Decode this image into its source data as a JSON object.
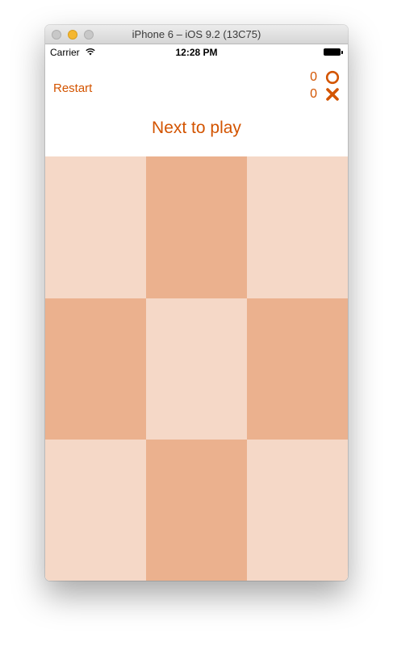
{
  "window": {
    "title": "iPhone 6 – iOS 9.2 (13C75)"
  },
  "status_bar": {
    "carrier": "Carrier",
    "time": "12:28 PM",
    "wifi_icon": "wifi-icon",
    "battery_icon": "battery-icon"
  },
  "game": {
    "restart_label": "Restart",
    "next_label": "Next to play",
    "scores": [
      {
        "player": "O",
        "value": "0",
        "icon": "circle-icon"
      },
      {
        "player": "X",
        "value": "0",
        "icon": "cross-icon"
      }
    ],
    "board": [
      [
        "",
        "",
        ""
      ],
      [
        "",
        "",
        ""
      ],
      [
        "",
        "",
        ""
      ]
    ]
  },
  "colors": {
    "accent": "#d35400",
    "cell_light": "#f5d8c7",
    "cell_dark": "#ebb18e"
  }
}
